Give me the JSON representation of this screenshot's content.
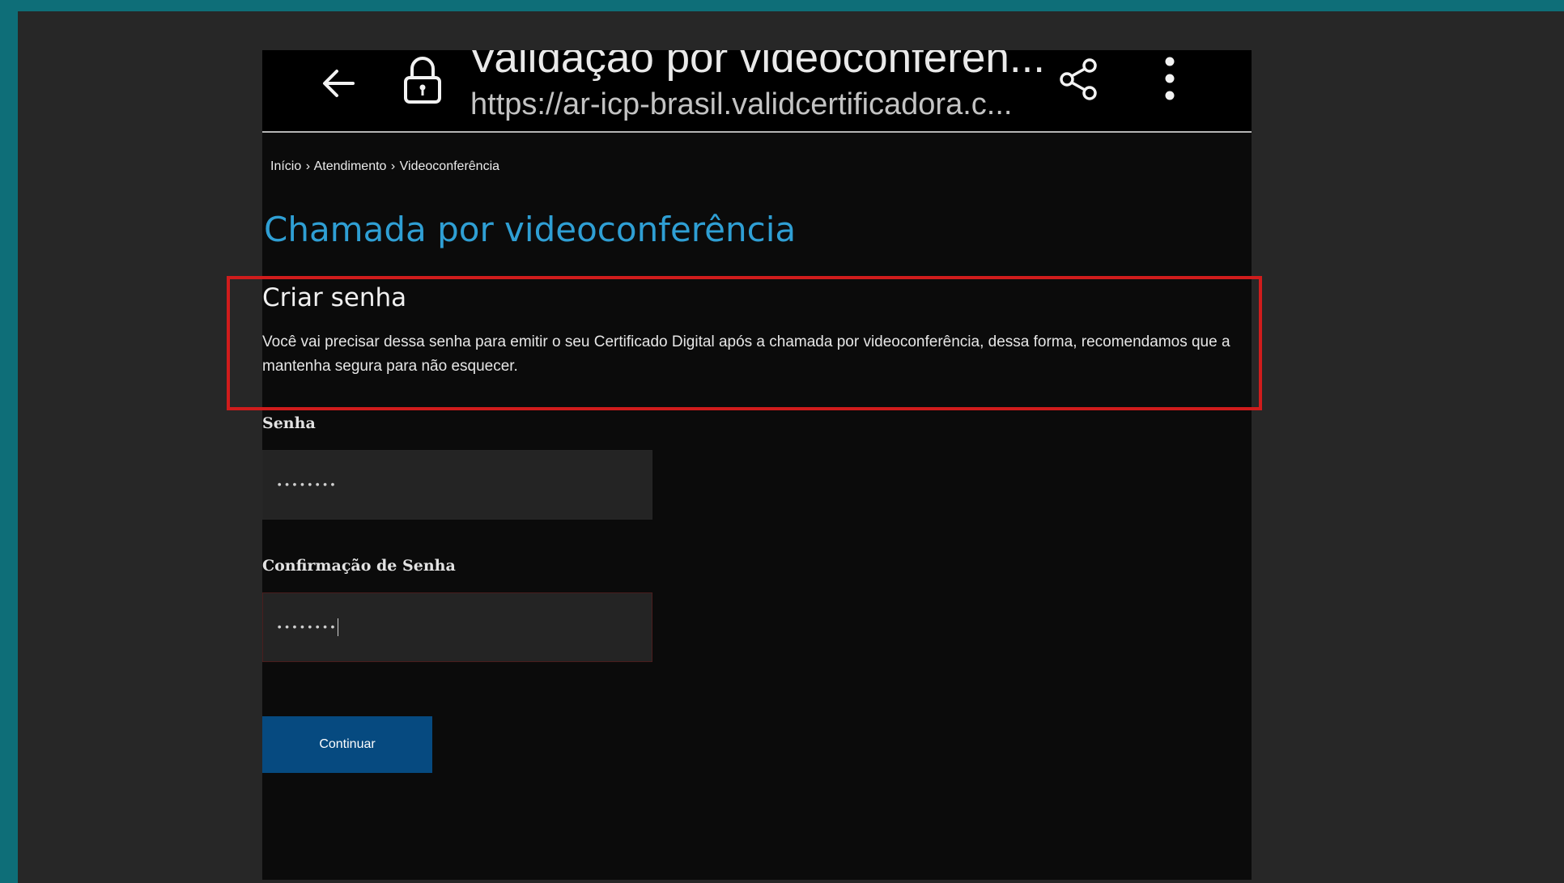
{
  "colors": {
    "accent_title": "#2f9fd4",
    "button_bg": "#064a80",
    "highlight": "#d01c1c",
    "page_bg": "#0b0b0b",
    "frame_bg": "#272727",
    "frame_border": "#0e6e78"
  },
  "browser": {
    "back_icon": "arrow-left-icon",
    "lock_icon": "lock-icon",
    "title": "Validação por videoconferen...",
    "url": "https://ar-icp-brasil.validcertificadora.c...",
    "share_icon": "share-icon",
    "menu_icon": "more-vertical-icon"
  },
  "breadcrumb": {
    "items": [
      "Início",
      "Atendimento",
      "Videoconferência"
    ],
    "separators": [
      "›",
      "›"
    ]
  },
  "page": {
    "title": "Chamada por videoconferência"
  },
  "create_password": {
    "heading": "Criar senha",
    "description": "Você vai precisar dessa senha para emitir o seu Certificado Digital após a chamada por videoconferência, dessa forma, recomendamos que a mantenha segura para não esquecer."
  },
  "form": {
    "password_label": "Senha",
    "password_value": "••••••••",
    "confirm_label": "Confirmação de Senha",
    "confirm_value": "••••••••",
    "submit_label": "Continuar"
  }
}
